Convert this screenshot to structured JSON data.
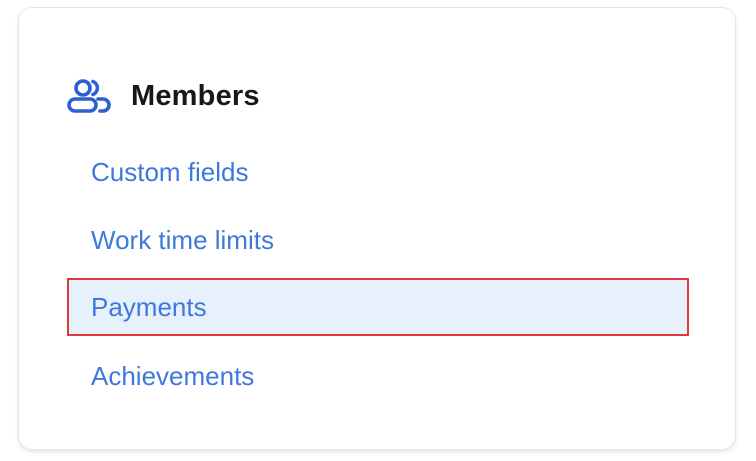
{
  "section": {
    "title": "Members",
    "icon": "members-icon"
  },
  "menu": {
    "items": [
      {
        "label": "Custom fields"
      },
      {
        "label": "Work time limits"
      },
      {
        "label": "Payments",
        "selected": true
      },
      {
        "label": "Achievements"
      }
    ]
  },
  "colors": {
    "link": "#3f78dd",
    "icon": "#2c5fd3",
    "selected_bg": "#e7f1fb",
    "selected_border": "#e0383b",
    "title": "#16181d"
  }
}
